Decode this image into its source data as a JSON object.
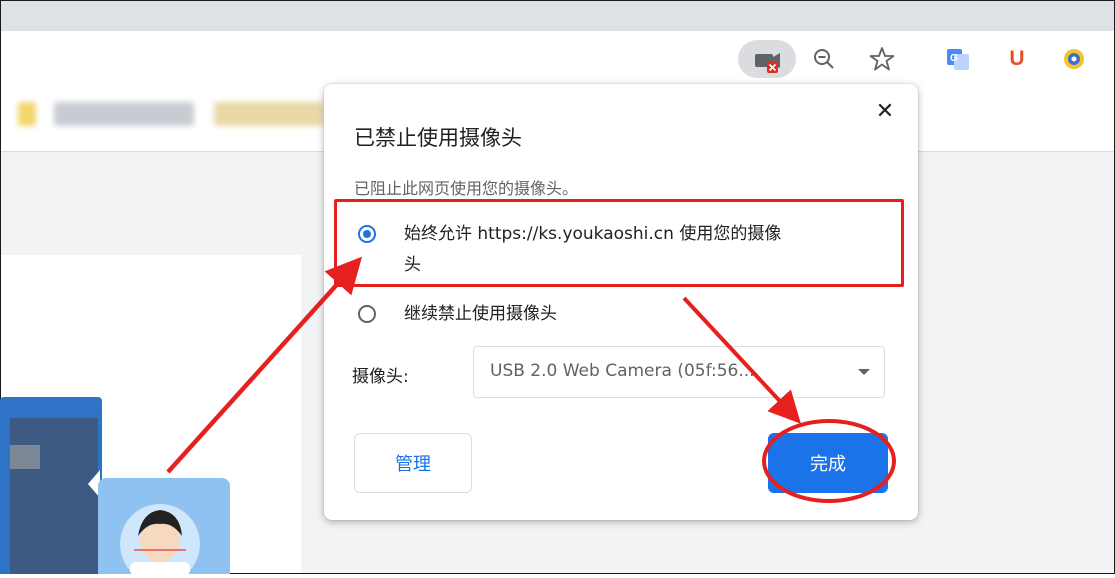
{
  "dialog": {
    "title": "已禁止使用摄像头",
    "close_glyph": "✕",
    "description": "已阻止此网页使用您的摄像头。",
    "options": [
      {
        "line1": "始终允许 https://ks.youkaoshi.cn 使用您的摄像",
        "line2": "头",
        "checked": true
      },
      {
        "line1": "继续禁止使用摄像头",
        "checked": false
      }
    ],
    "camera_label": "摄像头:",
    "camera_value": "USB 2.0 Web Camera (05f:56...",
    "manage_label": "管理",
    "done_label": "完成"
  },
  "toolbar": {
    "icons": [
      "camera-blocked-icon",
      "zoom-out-icon",
      "bookmark-star-icon",
      "google-translate-icon",
      "u-extension-icon",
      "extension-icon"
    ],
    "u_letter": "U"
  },
  "colors": {
    "accent": "#1a73e8",
    "annotation_red": "#e5201f",
    "blocked_red": "#d93025"
  }
}
